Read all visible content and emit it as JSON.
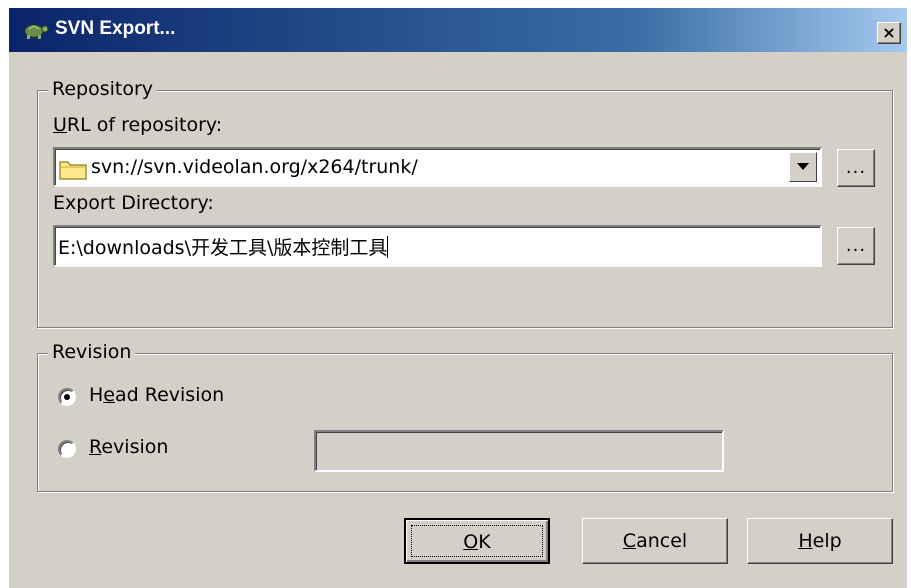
{
  "window": {
    "title": "SVN Export...",
    "close_glyph": "×"
  },
  "repository_group": {
    "legend": "Repository",
    "url_label_prefix": "",
    "url_label_mnemonic": "U",
    "url_label_rest": "RL of repository:",
    "url_value": "svn://svn.videolan.org/x264/trunk/",
    "export_dir_label": "Export Directory:",
    "export_dir_value": "E:\\downloads\\开发工具\\版本控制工具",
    "browse_label": "..."
  },
  "revision_group": {
    "legend": "Revision",
    "head_prefix": "H",
    "head_mnemonic": "e",
    "head_rest": "ad Revision",
    "revision_mnemonic": "R",
    "revision_rest": "evision",
    "revision_value": "",
    "selected": "head"
  },
  "buttons": {
    "ok_mnemonic": "O",
    "ok_rest": "K",
    "cancel_mnemonic": "C",
    "cancel_rest": "ancel",
    "help_mnemonic": "H",
    "help_rest": "elp"
  },
  "icons": {
    "title": "tortoise-icon",
    "url": "folder-icon",
    "dropdown": "triangle-down-icon"
  }
}
